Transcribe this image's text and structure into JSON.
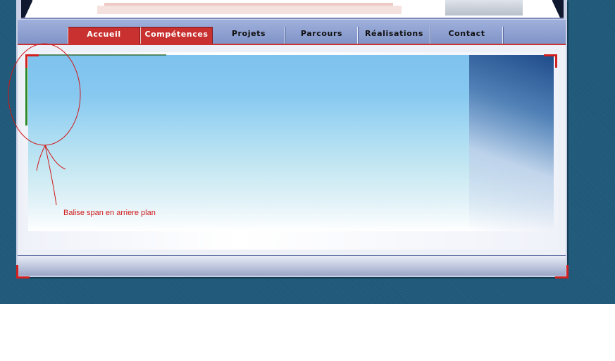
{
  "nav": {
    "items": [
      {
        "label": "Accueil"
      },
      {
        "label": "Compétences"
      },
      {
        "label": "Projets"
      },
      {
        "label": "Parcours"
      },
      {
        "label": "Réalisations"
      },
      {
        "label": "Contact"
      }
    ]
  },
  "annotation": {
    "label": "Balise span en arriere plan"
  },
  "colors": {
    "page_background": "#1e5878",
    "accent_red": "#c8312f",
    "nav_blue": "#8fa2d2"
  }
}
